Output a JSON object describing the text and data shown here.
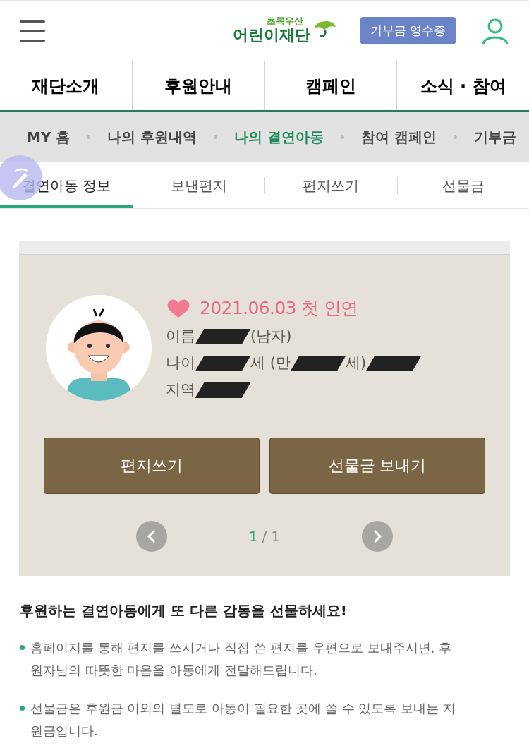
{
  "header": {
    "logo_small": "초록우산",
    "logo_main": "어린이재단",
    "receipt_button": "기부금 영수증"
  },
  "main_nav": [
    {
      "label": "재단소개"
    },
    {
      "label": "후원안내"
    },
    {
      "label": "캠페인"
    },
    {
      "label": "소식 · 참여"
    }
  ],
  "sub_nav": [
    {
      "label": "MY 홈",
      "selected": false
    },
    {
      "label": "나의 후원내역",
      "selected": false
    },
    {
      "label": "나의 결연아동",
      "selected": true
    },
    {
      "label": "참여 캠페인",
      "selected": false
    },
    {
      "label": "기부금",
      "selected": false
    }
  ],
  "tabs": [
    {
      "label": "결연아동 정보",
      "selected": true
    },
    {
      "label": "보낸편지",
      "selected": false
    },
    {
      "label": "편지쓰기",
      "selected": false
    },
    {
      "label": "선물금",
      "selected": false
    }
  ],
  "child_card": {
    "first_date": "2021.06.03 첫 인연",
    "info": [
      [
        {
          "kind": "text",
          "text": "이름"
        },
        {
          "kind": "redacted"
        },
        {
          "kind": "text",
          "text": "(남자)"
        }
      ],
      [
        {
          "kind": "text",
          "text": "나이"
        },
        {
          "kind": "redacted"
        },
        {
          "kind": "text",
          "text": "세 (만"
        },
        {
          "kind": "redacted"
        },
        {
          "kind": "text",
          "text": "세)"
        },
        {
          "kind": "redacted"
        }
      ],
      [
        {
          "kind": "text",
          "text": "지역"
        },
        {
          "kind": "redacted"
        }
      ]
    ],
    "buttons": [
      "편지쓰기",
      "선물금 보내기"
    ],
    "page_current": "1",
    "page_total": "/ 1"
  },
  "description": {
    "title": "후원하는 결연아동에게 또 다른 감동을 선물하세요!",
    "bullets": [
      "홈페이지를 통해 편지를 쓰시거나 직접 쓴 편지를 우편으로 보내주시면, 후원자님의 따뜻한 마음을 아동에게 전달해드립니다.",
      "선물금은 후원금 이외의 별도로 아동이 필요한 곳에 쓸 수 있도록 보내는 지원금입니다."
    ]
  }
}
